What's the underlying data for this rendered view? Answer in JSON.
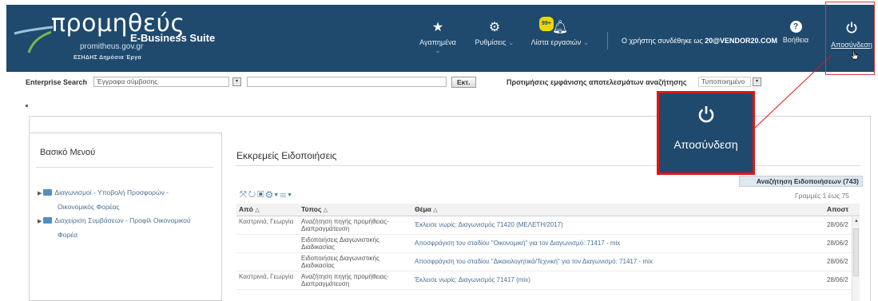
{
  "header": {
    "logo_text": "προμηθεύς",
    "suite_label": "E-Business Suite",
    "domain": "promitheus.gov.gr",
    "tagline": "ΕΣΗΔΗΣ  Δημόσια Έργα",
    "nav": [
      {
        "label": "Αγαπημένα",
        "icon": "star-icon"
      },
      {
        "label": "Ρυθμίσεις",
        "icon": "gear-icon"
      },
      {
        "label": "Λίστα εργασιών",
        "icon": "bell-icon",
        "badge": "99+"
      }
    ],
    "user_text_prefix": "Ο χρήστης συνδέθηκε ως",
    "user_name": "20@VENDOR20.COM",
    "help_label": "Βοήθεια",
    "help_icon": "?",
    "logout_label": "Αποσύνδεση"
  },
  "search": {
    "label": "Enterprise Search",
    "scope_value": "Έγγραφα σύμβασης",
    "query_value": "",
    "go_label": "Εκτ.",
    "display_pref_label": "Προτιμήσεις εμφάνισης αποτελεσμάτων αναζήτησης",
    "display_pref_value": "Τυποποιημένο"
  },
  "menu": {
    "title": "Βασικό Μενού",
    "items": [
      {
        "line1": "Διαγωνισμοί - Υποβολή Προσφορών -",
        "line2": "Οικονομικός Φορέας"
      },
      {
        "line1": "Διαχείριση Συμβάσεων - Προφίλ Οικονομικού",
        "line2": "Φορέα"
      }
    ]
  },
  "notifications": {
    "title": "Εκκρεμείς Ειδοποιήσεις",
    "all_button": "Αναζήτηση Ειδοποιήσεων (743)",
    "rows_count": "Γραμμές 1 έως 75",
    "columns": [
      "Από",
      "Τύπος",
      "Θέμα",
      "Αποστ"
    ],
    "rows": [
      {
        "from": "Καστρινιά, Γεωργία",
        "type": "Αναζήτηση πηγής προμήθειας-Διαπραγμάτευση",
        "subject": "Έκλεισε νωρίς: Διαγωνισμός 71420 (ΜΕΛΕΤΗ/2017)",
        "date": "28/06/2"
      },
      {
        "from": "",
        "type": "Ειδοποιήσεις Διαγωνιστικής Διαδικασίας",
        "subject": "Αποσφράγιση του σταδίου \"Οικονομική\" για τον Διαγωνισμό: 71417 - mix",
        "date": "28/06/2"
      },
      {
        "from": "",
        "type": "Ειδοποιήσεις Διαγωνιστικής Διαδικασίας",
        "subject": "Αποσφράγιση του σταδίου \"Δικαιολογητικά/Τεχνική\" για τον Διαγωνισμό: 71417 - mix",
        "date": "28/06/2"
      },
      {
        "from": "Καστρινιά, Γεωργία",
        "type": "Αναζήτηση πηγής προμήθειας-Διαπραγμάτευση",
        "subject": "Έκλεισε νωρίς: Διαγωνισμός 71417 (mix)",
        "date": "28/06/2"
      }
    ]
  },
  "callout": {
    "label": "Αποσύνδεση",
    "icon": "power-icon",
    "highlight_color": "#e01616"
  },
  "colors": {
    "header_bg": "#1f4a6e",
    "link": "#4a6e95",
    "badge": "#e9d800"
  }
}
